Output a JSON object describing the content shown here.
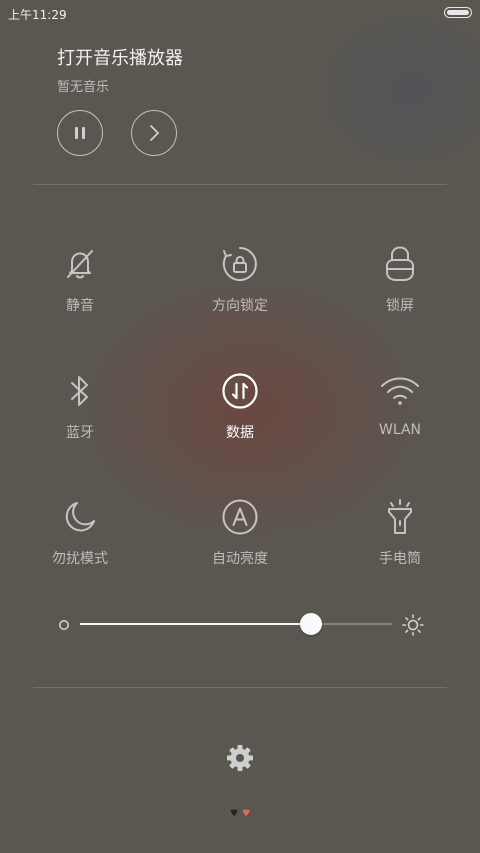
{
  "status_bar": {
    "time": "上午11:29"
  },
  "music": {
    "title": "打开音乐播放器",
    "subtitle": "暂无音乐",
    "pause_icon": "pause-icon",
    "next_icon": "chevron-right-icon"
  },
  "toggles": [
    {
      "label": "静音",
      "icon": "bell-off-icon",
      "active": false
    },
    {
      "label": "方向锁定",
      "icon": "rotation-lock-icon",
      "active": false
    },
    {
      "label": "锁屏",
      "icon": "lock-icon",
      "active": false
    },
    {
      "label": "蓝牙",
      "icon": "bluetooth-icon",
      "active": false
    },
    {
      "label": "数据",
      "icon": "data-icon",
      "active": true
    },
    {
      "label": "WLAN",
      "icon": "wifi-icon",
      "active": false
    },
    {
      "label": "勿扰模式",
      "icon": "moon-icon",
      "active": false
    },
    {
      "label": "自动亮度",
      "icon": "auto-brightness-icon",
      "active": false
    },
    {
      "label": "手电筒",
      "icon": "flashlight-icon",
      "active": false
    }
  ],
  "brightness": {
    "level": 0.74,
    "min_icon": "brightness-low-icon",
    "max_icon": "brightness-high-icon"
  },
  "settings_icon": "gear-icon",
  "pager": {
    "pages": 2,
    "current": 2,
    "inactive_color": "#222222",
    "active_color": "#e06a6a"
  }
}
